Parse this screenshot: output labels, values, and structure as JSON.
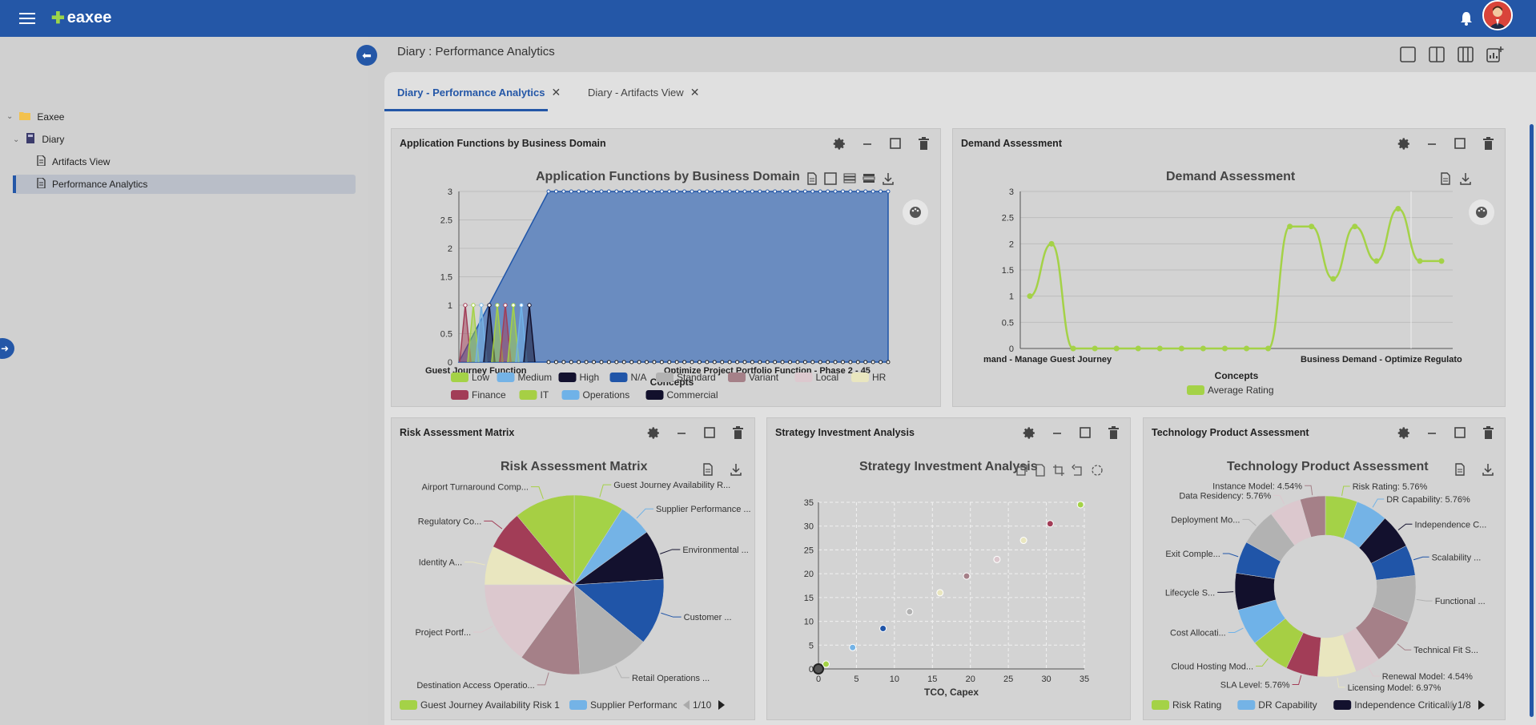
{
  "app": {
    "logo": "eaxee"
  },
  "breadcrumb": "Diary : Performance Analytics",
  "tree": {
    "root": "Eaxee",
    "folder": "Diary",
    "items": [
      "Artifacts View",
      "Performance Analytics"
    ]
  },
  "tabs": [
    {
      "label": "Diary - Performance Analytics",
      "active": true
    },
    {
      "label": "Diary - Artifacts View",
      "active": false
    }
  ],
  "panels": {
    "app_functions": {
      "header": "Application Functions by Business Domain",
      "chart_title": "Application Functions by Business Domain",
      "xlabel": "Concepts",
      "xticks": [
        "Guest Journey Function",
        "Optimize Project Portfolio Function - Phase 2 - 45"
      ],
      "yticks": [
        "0",
        "0.5",
        "1",
        "1.5",
        "2",
        "2.5",
        "3"
      ],
      "legend": [
        "Low",
        "Medium",
        "High",
        "N/A",
        "Standard",
        "Variant",
        "Local",
        "HR",
        "Finance",
        "IT",
        "Operations",
        "Commercial"
      ]
    },
    "demand": {
      "header": "Demand Assessment",
      "chart_title": "Demand Assessment",
      "xlabel": "Concepts",
      "xticks": [
        "mand - Manage Guest Journey",
        "Business Demand - Optimize Regulato"
      ],
      "yticks": [
        "0",
        "0.5",
        "1",
        "1.5",
        "2",
        "2.5",
        "3"
      ],
      "legend": [
        "Average Rating"
      ]
    },
    "risk": {
      "header": "Risk Assessment Matrix",
      "chart_title": "Risk Assessment Matrix",
      "labels": [
        "Guest Journey Availability R...",
        "Supplier Performance ...",
        "Environmental ...",
        "Customer ...",
        "Retail Operations ...",
        "Destination Access Operatio...",
        "Project Portf...",
        "Identity A...",
        "Regulatory Co...",
        "Airport Turnaround Comp..."
      ],
      "legend": [
        "Guest Journey Availability Risk 1",
        "Supplier Performance C"
      ],
      "pager": "1/10"
    },
    "strategy": {
      "header": "Strategy Investment Analysis",
      "chart_title": "Strategy Investment Analysis",
      "xlabel": "TCO, Capex",
      "xticks": [
        "0",
        "5",
        "10",
        "15",
        "20",
        "25",
        "30",
        "35"
      ],
      "yticks": [
        "0",
        "5",
        "10",
        "15",
        "20",
        "25",
        "30",
        "35"
      ]
    },
    "tech": {
      "header": "Technology Product Assessment",
      "chart_title": "Technology Product Assessment",
      "labels": [
        "Risk Rating: 5.76%",
        "DR Capability: 5.76%",
        "Independence C...",
        "Scalability ...",
        "Functional ...",
        "Technical Fit S...",
        "Renewal Model: 4.54%",
        "Licensing Model: 6.97%",
        "SLA Level: 5.76%",
        "Cloud Hosting Mod...",
        "Cost Allocati...",
        "Lifecycle S...",
        "Exit Comple...",
        "Deployment Mo...",
        "Data Residency: 5.76%",
        "Instance Model: 4.54%"
      ],
      "legend": [
        "Risk Rating",
        "DR Capability",
        "Independence Criticality"
      ],
      "pager": "1/8"
    }
  },
  "chart_data": [
    {
      "type": "area",
      "title": "Application Functions by Business Domain",
      "xlabel": "Concepts",
      "ylim": [
        0,
        3
      ],
      "series": [
        {
          "name": "Low",
          "values": [
            0,
            1,
            0
          ]
        },
        {
          "name": "Medium",
          "values": [
            0,
            1,
            0
          ]
        },
        {
          "name": "High",
          "values": [
            0,
            1,
            0
          ]
        },
        {
          "name": "N/A",
          "values": [
            0,
            3,
            3
          ]
        },
        {
          "name": "Finance",
          "values": [
            0,
            1,
            0
          ]
        },
        {
          "name": "IT",
          "values": [
            0,
            1,
            0
          ]
        },
        {
          "name": "Operations",
          "values": [
            0,
            1,
            0
          ]
        },
        {
          "name": "Commercial",
          "values": [
            0,
            1,
            0
          ]
        }
      ]
    },
    {
      "type": "line",
      "title": "Demand Assessment",
      "xlabel": "Concepts",
      "ylim": [
        0,
        3
      ],
      "series": [
        {
          "name": "Average Rating",
          "values": [
            1,
            2,
            0,
            0,
            0,
            0,
            0,
            0,
            0,
            0,
            0,
            0,
            2.33,
            2.33,
            1.33,
            2.33,
            1.67,
            2.67,
            1.67,
            1.67
          ]
        }
      ]
    },
    {
      "type": "pie",
      "title": "Risk Assessment Matrix",
      "categories": [
        "Guest Journey Availability Risk 1",
        "Supplier Performance",
        "Environmental",
        "Customer",
        "Retail Operations",
        "Destination Access Operations",
        "Project Portfolio",
        "Identity Access",
        "Regulatory Compliance",
        "Airport Turnaround Compliance"
      ],
      "values": [
        9,
        6,
        9,
        12,
        13,
        11,
        15,
        7,
        7,
        11
      ]
    },
    {
      "type": "scatter",
      "title": "Strategy Investment Analysis",
      "xlabel": "TCO, Capex",
      "xlim": [
        0,
        35
      ],
      "ylim": [
        0,
        35
      ],
      "x": [
        0,
        1,
        4.5,
        8.5,
        12,
        16,
        19.5,
        23.5,
        27,
        30.5,
        34.5
      ],
      "y": [
        0,
        1,
        4.5,
        8.5,
        12,
        16,
        19.5,
        23,
        27,
        30.5,
        34.5
      ]
    },
    {
      "type": "pie",
      "title": "Technology Product Assessment",
      "categories": [
        "Risk Rating",
        "DR Capability",
        "Independence Criticality",
        "Scalability",
        "Functional",
        "Technical Fit",
        "Renewal Model",
        "Licensing Model",
        "SLA Level",
        "Cloud Hosting Model",
        "Cost Allocation",
        "Lifecycle",
        "Exit Complexity",
        "Deployment Model",
        "Data Residency",
        "Instance Model"
      ],
      "values": [
        5.76,
        5.76,
        6.2,
        5.5,
        8.5,
        8.5,
        4.54,
        6.97,
        5.76,
        7.2,
        6.6,
        6.6,
        5.8,
        6.7,
        5.76,
        4.54
      ]
    }
  ],
  "colors": {
    "primary": "#2457a7",
    "palette": [
      "#a4d247",
      "#74b3e6",
      "#13112e",
      "#2055a8",
      "#b2b2b2",
      "#a58088",
      "#dcc8ce",
      "#e9e6bf",
      "#a23d57",
      "#a6cf44",
      "#6fb2e8",
      "#12102c"
    ]
  }
}
